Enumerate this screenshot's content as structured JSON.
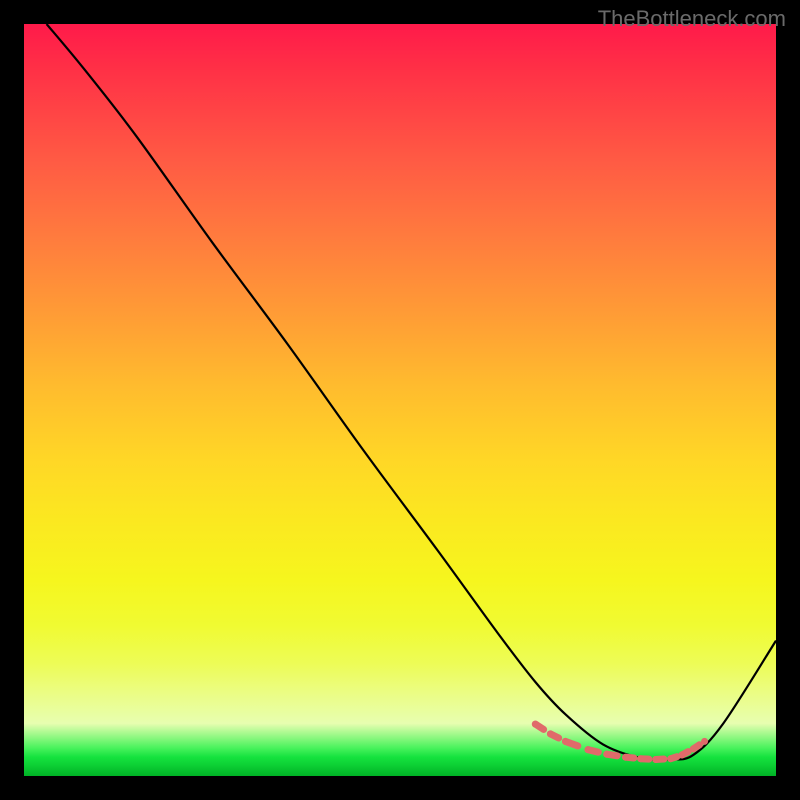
{
  "watermark": "TheBottleneck.com",
  "chart_data": {
    "type": "line",
    "title": "",
    "xlabel": "",
    "ylabel": "",
    "xlim": [
      0,
      100
    ],
    "ylim": [
      0,
      100
    ],
    "series": [
      {
        "name": "main-curve",
        "x": [
          3,
          8,
          15,
          25,
          35,
          45,
          55,
          63,
          68,
          72,
          77,
          82,
          86,
          89,
          93,
          100
        ],
        "y": [
          100,
          94,
          85,
          71,
          57.5,
          43.5,
          30,
          19,
          12.5,
          8.2,
          4.2,
          2.4,
          2.2,
          2.8,
          7,
          18
        ],
        "color": "#000000"
      },
      {
        "name": "highlight-dots",
        "x": [
          68,
          70,
          72,
          75,
          77.5,
          80,
          82,
          84,
          86,
          87.5,
          89,
          90.5
        ],
        "y": [
          6.9,
          5.6,
          4.6,
          3.5,
          2.9,
          2.5,
          2.3,
          2.2,
          2.3,
          2.8,
          3.6,
          4.6
        ],
        "color": "#e06a6a"
      }
    ]
  }
}
